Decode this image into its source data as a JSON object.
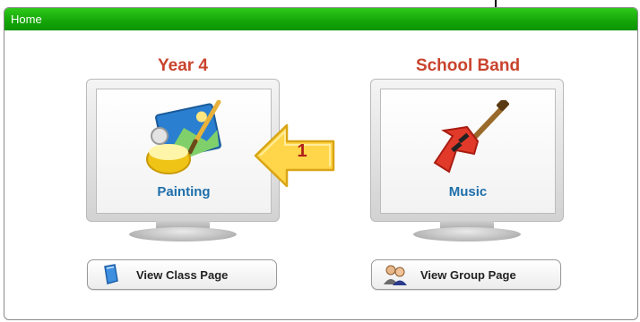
{
  "window": {
    "title": "Home"
  },
  "cards": [
    {
      "title": "Year 4",
      "screen_label": "Painting",
      "button_label": "View Class Page",
      "art_icon": "painting-palette-icon",
      "button_icon": "class-book-icon"
    },
    {
      "title": "School Band",
      "screen_label": "Music",
      "button_label": "View Group Page",
      "art_icon": "electric-guitar-icon",
      "button_icon": "group-people-icon"
    }
  ],
  "callout": {
    "number": "1",
    "icon": "arrow-callout-icon"
  },
  "colors": {
    "titlebar": "#13a507",
    "card_title": "#c9432d",
    "screen_label": "#1e6fab",
    "callout": "#ffd54a"
  }
}
